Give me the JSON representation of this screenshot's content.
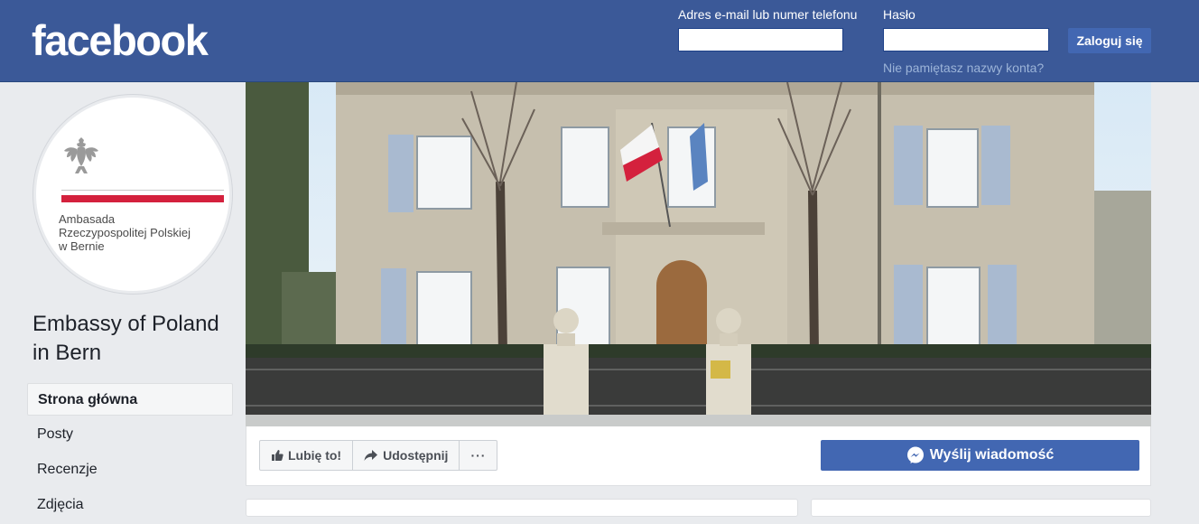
{
  "header": {
    "logo": "facebook",
    "email_label": "Adres e-mail lub numer telefonu",
    "password_label": "Hasło",
    "email_value": "",
    "password_value": "",
    "login_button": "Zaloguj się",
    "forgot_link": "Nie pamiętasz nazwy konta?"
  },
  "profile": {
    "picture_text": "Ambasada\nRzeczypospolitej Polskiej\nw Bernie",
    "page_name": "Embassy of Poland in Bern"
  },
  "sidebar": {
    "items": [
      {
        "label": "Strona główna"
      },
      {
        "label": "Posty"
      },
      {
        "label": "Recenzje"
      },
      {
        "label": "Zdjęcia"
      }
    ]
  },
  "actions": {
    "like": "Lubię to!",
    "share": "Udostępnij",
    "more": "···",
    "message": "Wyślij wiadomość"
  },
  "colors": {
    "brand": "#3b5998",
    "button": "#4267b2",
    "flag_red": "#d4213d"
  }
}
